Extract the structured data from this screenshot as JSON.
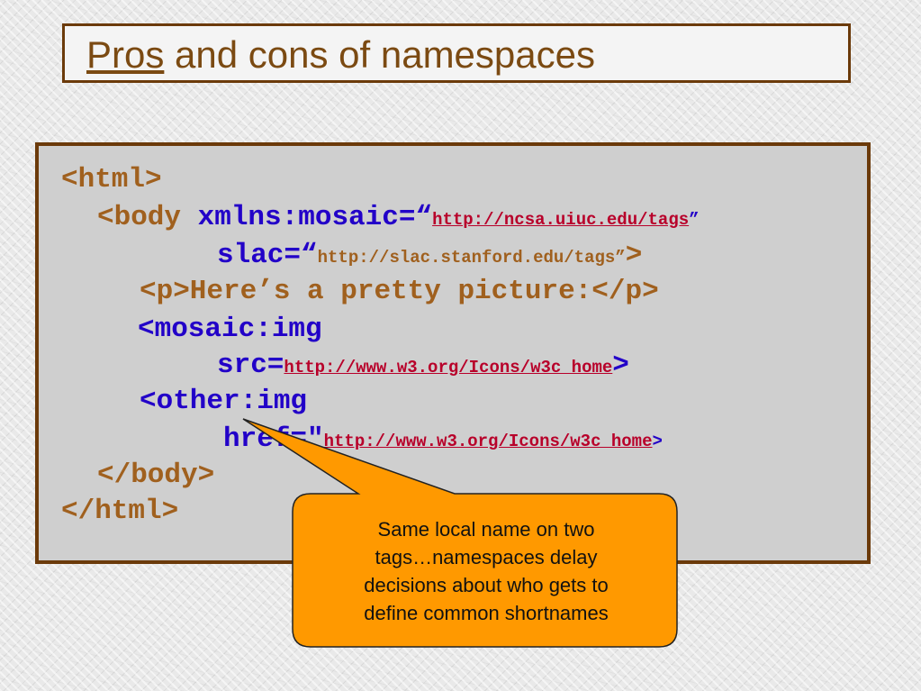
{
  "slide": {
    "title_pros": "Pros",
    "title_rest": " and cons of namespaces"
  },
  "code": {
    "l1": "<html>",
    "l2_tag": "<body ",
    "l2_attr": "xmlns:mosaic=“",
    "l2_url": "http://ncsa.uiuc.edu/tags",
    "l2_close": "”",
    "l3_attr": "slac=“",
    "l3_url": "http://slac.stanford.edu/tags”",
    "l3_end": ">",
    "l4": "<p>Here’s a pretty picture:</p>",
    "l5": "<mosaic:img",
    "l6_attr": "src=",
    "l6_url": "http://www.w3.org/Icons/w3c_home",
    "l6_end": ">",
    "l7": "<other:img",
    "l8_attr": "href=\"",
    "l8_url": "http://www.w3.org/Icons/w3c_home",
    "l8_end": ">",
    "l9": "</body>",
    "l10": "</html>"
  },
  "callout": {
    "lines": [
      "Same local name on two",
      "tags…namespaces delay",
      "decisions about who gets to",
      "define common shortnames"
    ],
    "fill": "#ff9900",
    "stroke": "#222222"
  },
  "colors": {
    "border": "#6b3a0a",
    "tag_brown": "#a0601e",
    "attr_blue": "#2200c8",
    "link_red": "#b8002a"
  }
}
